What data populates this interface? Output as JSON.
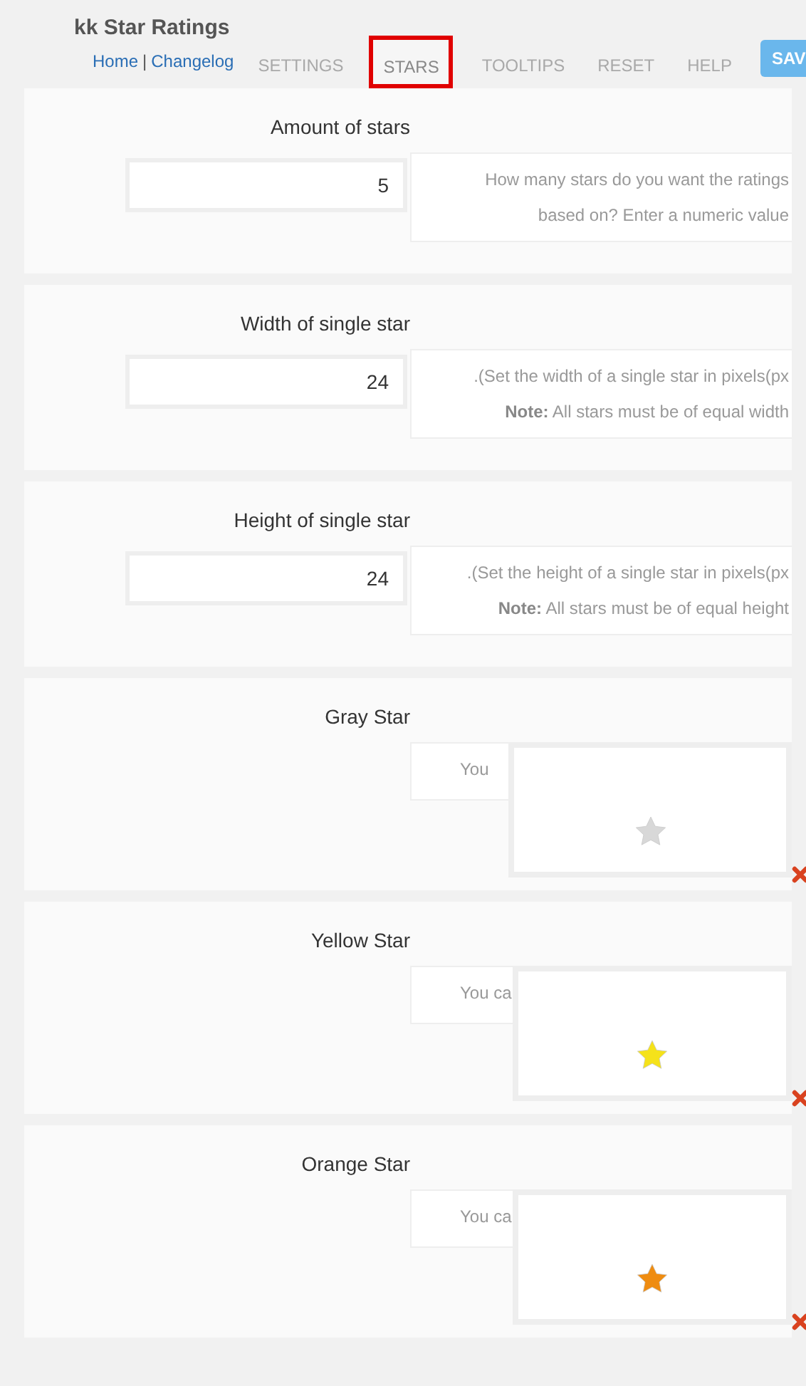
{
  "header": {
    "title": "kk Star Ratings",
    "links": [
      "Home",
      "Changelog"
    ],
    "separator": "|"
  },
  "tabs": [
    {
      "label": "SETTINGS",
      "selected": false
    },
    {
      "label": "STARS",
      "selected": true
    },
    {
      "label": "TOOLTIPS",
      "selected": false
    },
    {
      "label": "RESET",
      "selected": false
    },
    {
      "label": "HELP",
      "selected": false
    }
  ],
  "save_button": "SAV",
  "sections": [
    {
      "kind": "number",
      "label": "Amount of stars",
      "value": "5",
      "description": [
        "How many stars do you want the ratings",
        "based on? Enter a numeric value"
      ]
    },
    {
      "kind": "number",
      "label": "Width of single star",
      "value": "24",
      "description": [
        ".(Set the width of a single star in pixels(px",
        "**Note:** All stars must be of equal width"
      ]
    },
    {
      "kind": "number",
      "label": "Height of single star",
      "value": "24",
      "description": [
        ".(Set the height of a single star in pixels(px",
        "**Note:** All stars must be of equal height"
      ]
    },
    {
      "kind": "image",
      "label": "Gray Star",
      "description": [
        "You"
      ],
      "color": "#d8d8d8"
    },
    {
      "kind": "image",
      "label": "Yellow Star",
      "description": [
        "You ca"
      ],
      "color": "#f5e21a"
    },
    {
      "kind": "image",
      "label": "Orange Star",
      "description": [
        "You ca"
      ],
      "color": "#ef8c10"
    }
  ]
}
